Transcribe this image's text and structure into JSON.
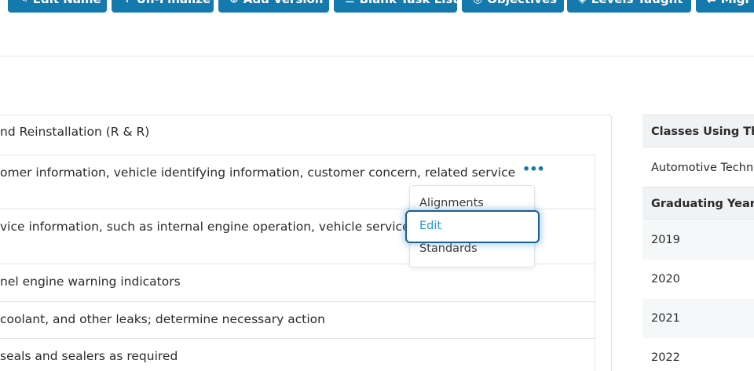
{
  "toolbar": {
    "buttons": [
      {
        "label": "Edit Name",
        "icon": "✎"
      },
      {
        "label": "Un-Finalize",
        "icon": "↑"
      },
      {
        "label": "Add Version",
        "icon": "⊕"
      },
      {
        "label": "Blank Task List",
        "icon": "☰"
      },
      {
        "label": "Objectives",
        "icon": "◎"
      },
      {
        "label": "Levels Taught",
        "icon": "◈"
      },
      {
        "label": "Migr",
        "icon": "⇄"
      }
    ]
  },
  "task_panel": {
    "title": "nd Reinstallation (R & R)",
    "tasks": [
      "omer information, vehicle identifying information, customer concern, related service",
      "vice information, such as internal engine operation, vehicle service",
      "nel engine warning indicators",
      "coolant, and other leaks; determine necessary action",
      "seals and sealers as required"
    ],
    "more_icon": "•••"
  },
  "dropdown": {
    "items": [
      "Alignments",
      "Edit",
      "Standards"
    ],
    "focused": "Edit"
  },
  "side_table": {
    "classes_header": "Classes Using This",
    "classes": [
      "Automotive Techn"
    ],
    "years_header": "Graduating Years",
    "years": [
      "2019",
      "2020",
      "2021",
      "2022"
    ]
  },
  "colors": {
    "primary": "#1479ad",
    "link": "#1d9bd8",
    "focus_ring": "#1b5f8e"
  }
}
